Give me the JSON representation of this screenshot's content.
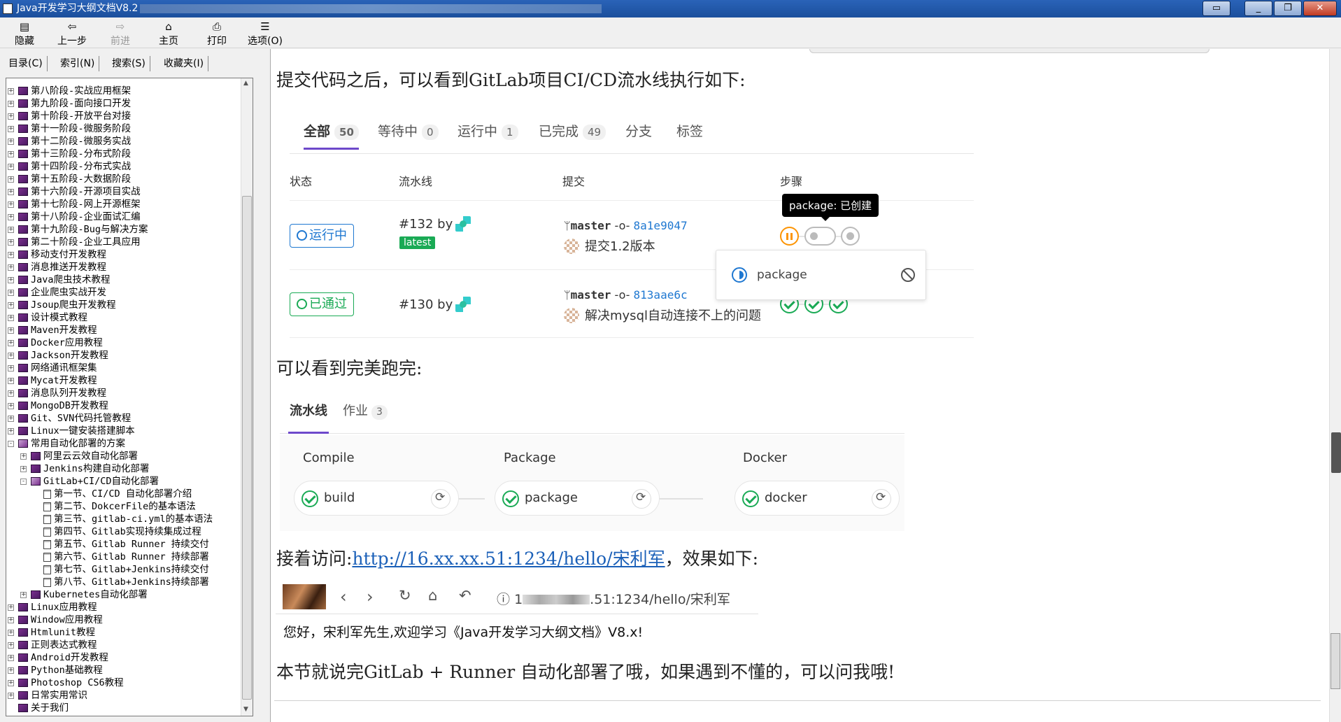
{
  "window": {
    "title": "Java开发学习大纲文档V8.2",
    "controls": [
      "▭",
      "_",
      "❐",
      "✕"
    ]
  },
  "toolbar": {
    "hide": "隐藏",
    "back": "上一步",
    "forward": "前进",
    "home": "主页",
    "print": "打印",
    "options": "选项(O)"
  },
  "nav_tabs": [
    "目录(C)",
    "索引(N)",
    "搜索(S)",
    "收藏夹(I)"
  ],
  "tree": [
    {
      "label": "第八阶段-实战应用框架",
      "level": 0,
      "type": "book",
      "exp": "+"
    },
    {
      "label": "第九阶段-面向接口开发",
      "level": 0,
      "type": "book",
      "exp": "+"
    },
    {
      "label": "第十阶段-开放平台对接",
      "level": 0,
      "type": "book",
      "exp": "+"
    },
    {
      "label": "第十一阶段-微服务阶段",
      "level": 0,
      "type": "book",
      "exp": "+"
    },
    {
      "label": "第十二阶段-微服务实战",
      "level": 0,
      "type": "book",
      "exp": "+"
    },
    {
      "label": "第十三阶段-分布式阶段",
      "level": 0,
      "type": "book",
      "exp": "+"
    },
    {
      "label": "第十四阶段-分布式实战",
      "level": 0,
      "type": "book",
      "exp": "+"
    },
    {
      "label": "第十五阶段-大数据阶段",
      "level": 0,
      "type": "book",
      "exp": "+"
    },
    {
      "label": "第十六阶段-开源项目实战",
      "level": 0,
      "type": "book",
      "exp": "+"
    },
    {
      "label": "第十七阶段-网上开源框架",
      "level": 0,
      "type": "book",
      "exp": "+"
    },
    {
      "label": "第十八阶段-企业面试汇编",
      "level": 0,
      "type": "book",
      "exp": "+"
    },
    {
      "label": "第十九阶段-Bug与解决方案",
      "level": 0,
      "type": "book",
      "exp": "+"
    },
    {
      "label": "第二十阶段-企业工具应用",
      "level": 0,
      "type": "book",
      "exp": "+"
    },
    {
      "label": "移动支付开发教程",
      "level": 0,
      "type": "book",
      "exp": "+"
    },
    {
      "label": "消息推送开发教程",
      "level": 0,
      "type": "book",
      "exp": "+"
    },
    {
      "label": "Java爬虫技术教程",
      "level": 0,
      "type": "book",
      "exp": "+"
    },
    {
      "label": "企业爬虫实战开发",
      "level": 0,
      "type": "book",
      "exp": "+"
    },
    {
      "label": "Jsoup爬虫开发教程",
      "level": 0,
      "type": "book",
      "exp": "+"
    },
    {
      "label": "设计模式教程",
      "level": 0,
      "type": "book",
      "exp": "+"
    },
    {
      "label": "Maven开发教程",
      "level": 0,
      "type": "book",
      "exp": "+"
    },
    {
      "label": "Docker应用教程",
      "level": 0,
      "type": "book",
      "exp": "+"
    },
    {
      "label": "Jackson开发教程",
      "level": 0,
      "type": "book",
      "exp": "+"
    },
    {
      "label": "网络通讯框架集",
      "level": 0,
      "type": "book",
      "exp": "+"
    },
    {
      "label": "Mycat开发教程",
      "level": 0,
      "type": "book",
      "exp": "+"
    },
    {
      "label": "消息队列开发教程",
      "level": 0,
      "type": "book",
      "exp": "+"
    },
    {
      "label": "MongoDB开发教程",
      "level": 0,
      "type": "book",
      "exp": "+"
    },
    {
      "label": "Git、SVN代码托管教程",
      "level": 0,
      "type": "book",
      "exp": "+"
    },
    {
      "label": "Linux一键安装搭建脚本",
      "level": 0,
      "type": "book",
      "exp": "+"
    },
    {
      "label": "常用自动化部署的方案",
      "level": 0,
      "type": "open",
      "exp": "-"
    },
    {
      "label": "阿里云云效自动化部署",
      "level": 1,
      "type": "book",
      "exp": "+"
    },
    {
      "label": "Jenkins构建自动化部署",
      "level": 1,
      "type": "book",
      "exp": "+"
    },
    {
      "label": "GitLab+CI/CD自动化部署",
      "level": 1,
      "type": "open",
      "exp": "-"
    },
    {
      "label": "第一节、CI/CD 自动化部署介绍",
      "level": 2,
      "type": "doc",
      "exp": ""
    },
    {
      "label": "第二节、DokcerFile的基本语法",
      "level": 2,
      "type": "doc",
      "exp": ""
    },
    {
      "label": "第三节、gitlab-ci.yml的基本语法",
      "level": 2,
      "type": "doc",
      "exp": ""
    },
    {
      "label": "第四节、Gitlab实现持续集成过程",
      "level": 2,
      "type": "doc",
      "exp": ""
    },
    {
      "label": "第五节、Gitlab Runner 持续交付",
      "level": 2,
      "type": "doc",
      "exp": ""
    },
    {
      "label": "第六节、Gitlab Runner 持续部署",
      "level": 2,
      "type": "doc",
      "exp": ""
    },
    {
      "label": "第七节、Gitlab+Jenkins持续交付",
      "level": 2,
      "type": "doc",
      "exp": ""
    },
    {
      "label": "第八节、Gitlab+Jenkins持续部署",
      "level": 2,
      "type": "doc",
      "exp": ""
    },
    {
      "label": "Kubernetes自动化部署",
      "level": 1,
      "type": "book",
      "exp": "+"
    },
    {
      "label": "Linux应用教程",
      "level": 0,
      "type": "book",
      "exp": "+"
    },
    {
      "label": "Window应用教程",
      "level": 0,
      "type": "book",
      "exp": "+"
    },
    {
      "label": "Htmlunit教程",
      "level": 0,
      "type": "book",
      "exp": "+"
    },
    {
      "label": "正则表达式教程",
      "level": 0,
      "type": "book",
      "exp": "+"
    },
    {
      "label": "Android开发教程",
      "level": 0,
      "type": "book",
      "exp": "+"
    },
    {
      "label": "Python基础教程",
      "level": 0,
      "type": "book",
      "exp": "+"
    },
    {
      "label": "Photoshop CS6教程",
      "level": 0,
      "type": "book",
      "exp": "+"
    },
    {
      "label": "日常实用常识",
      "level": 0,
      "type": "book",
      "exp": "+"
    },
    {
      "label": "关于我们",
      "level": 0,
      "type": "book",
      "exp": ""
    }
  ],
  "article": {
    "p1": "提交代码之后，可以看到GitLab项目CI/CD流水线执行如下:",
    "p2": "可以看到完美跑完:",
    "p3_pre": "接着访问:",
    "p3_link": "http://16.xx.xx.51:1234/hello/宋利军",
    "p3_post": "，效果如下:",
    "p4": "本节就说完GitLab + Runner 自动化部署了哦，如果遇到不懂的，可以问我哦!"
  },
  "gitlab": {
    "tabs": [
      {
        "label": "全部",
        "count": "50"
      },
      {
        "label": "等待中",
        "count": "0"
      },
      {
        "label": "运行中",
        "count": "1"
      },
      {
        "label": "已完成",
        "count": "49"
      },
      {
        "label": "分支",
        "count": ""
      },
      {
        "label": "标签",
        "count": ""
      }
    ],
    "headers": {
      "status": "状态",
      "pipeline": "流水线",
      "commit": "提交",
      "stages": "步骤"
    },
    "rows": [
      {
        "status": "运行中",
        "id": "#132 by",
        "badge": "latest",
        "branch": "master",
        "sha": "8a1e9047",
        "message": "提交1.2版本"
      },
      {
        "status": "已通过",
        "id": "#130 by",
        "badge": "",
        "branch": "master",
        "sha": "813aae6c",
        "message": "解决mysql自动连接不上的问题"
      }
    ],
    "tooltip": "package: 已创建",
    "dropdown_job": "package"
  },
  "pipeline": {
    "tabs": [
      {
        "label": "流水线",
        "count": ""
      },
      {
        "label": "作业",
        "count": "3"
      }
    ],
    "stages": [
      {
        "title": "Compile",
        "job": "build"
      },
      {
        "title": "Package",
        "job": "package"
      },
      {
        "title": "Docker",
        "job": "docker"
      }
    ]
  },
  "browser": {
    "address_prefix": "1",
    "address_suffix": ".51:1234/hello/宋利军",
    "greeting": "您好，宋利军先生,欢迎学习《Java开发学习大纲文档》V8.x!"
  }
}
